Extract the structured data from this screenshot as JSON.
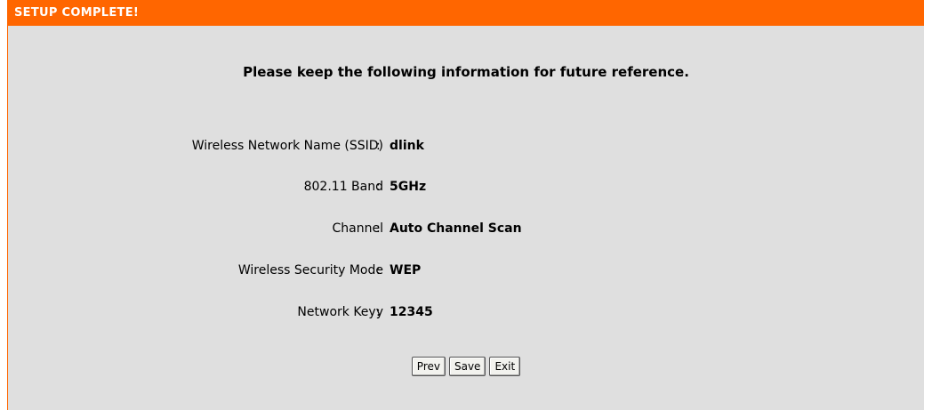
{
  "header": {
    "title": "SETUP COMPLETE!"
  },
  "intro": "Please keep the following information for future reference.",
  "fields": [
    {
      "label": "Wireless Network Name (SSID)",
      "value": "dlink"
    },
    {
      "label": "802.11 Band",
      "value": "5GHz"
    },
    {
      "label": "Channel",
      "value": "Auto Channel Scan"
    },
    {
      "label": "Wireless Security Mode",
      "value": "WEP"
    },
    {
      "label": "Network Keyy",
      "value": "12345"
    }
  ],
  "separator": ":",
  "buttons": {
    "prev_label": "Prev",
    "save_label": "Save",
    "exit_label": "Exit"
  },
  "colors": {
    "header_bg": "#ff6600",
    "panel_bg": "#dfdfdf"
  }
}
